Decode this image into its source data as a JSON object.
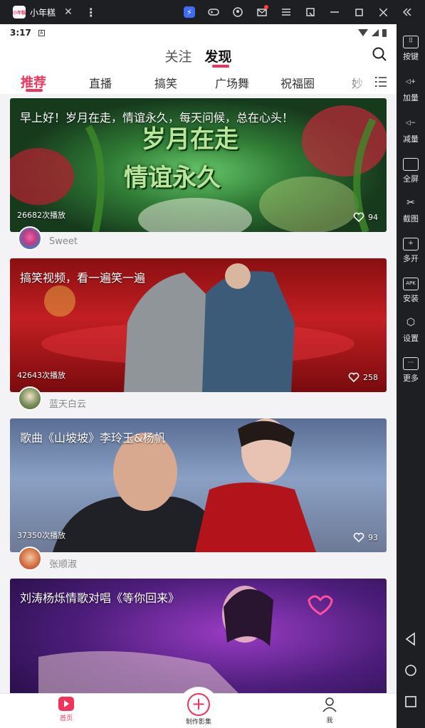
{
  "window": {
    "app_title": "小年糕",
    "app_logo_text": "小年糕",
    "close_glyph": "✕",
    "menu_glyph": "⋮",
    "toolbar_icons": [
      "bolt-icon",
      "gamepad-icon",
      "user-icon",
      "mail-icon",
      "menu-icon",
      "popout-icon",
      "minimize-icon",
      "maximize-icon",
      "close-icon",
      "collapse-icon"
    ]
  },
  "status_bar": {
    "time": "3:17",
    "notif_glyph": "A"
  },
  "top_nav": {
    "follow": "关注",
    "discover": "发现"
  },
  "categories": [
    "推荐",
    "直播",
    "搞笑",
    "广场舞",
    "祝福圈",
    "妙"
  ],
  "active_category": "推荐",
  "cards": [
    {
      "title": "早上好！岁月在走，情谊永久，每天问候，总在心头！",
      "plays": "26682次播放",
      "likes": "94",
      "author": "Sweet",
      "overlay_text_1": "岁月在走",
      "overlay_text_2": "情谊永久"
    },
    {
      "title": "搞笑视频，看一遍笑一遍",
      "plays": "42643次播放",
      "likes": "258",
      "author": "蓝天白云"
    },
    {
      "title": "歌曲《山坡坡》李玲玉&杨帆",
      "plays": "37350次播放",
      "likes": "93",
      "author": "张顺淑"
    },
    {
      "title": "刘涛杨烁情歌对唱《等你回来》",
      "plays": "",
      "likes": "",
      "author": ""
    }
  ],
  "bottom_nav": {
    "home": "首页",
    "create": "制作影集",
    "create_glyph": "+",
    "me": "我"
  },
  "sidebar": {
    "keys": "按键",
    "vol_up": "加量",
    "vol_down": "减量",
    "fullscreen": "全屏",
    "screenshot": "截图",
    "multi": "多开",
    "install": "安装",
    "settings": "设置",
    "more": "更多"
  },
  "colors": {
    "accent": "#f0335b",
    "chrome": "#1e1f23"
  }
}
